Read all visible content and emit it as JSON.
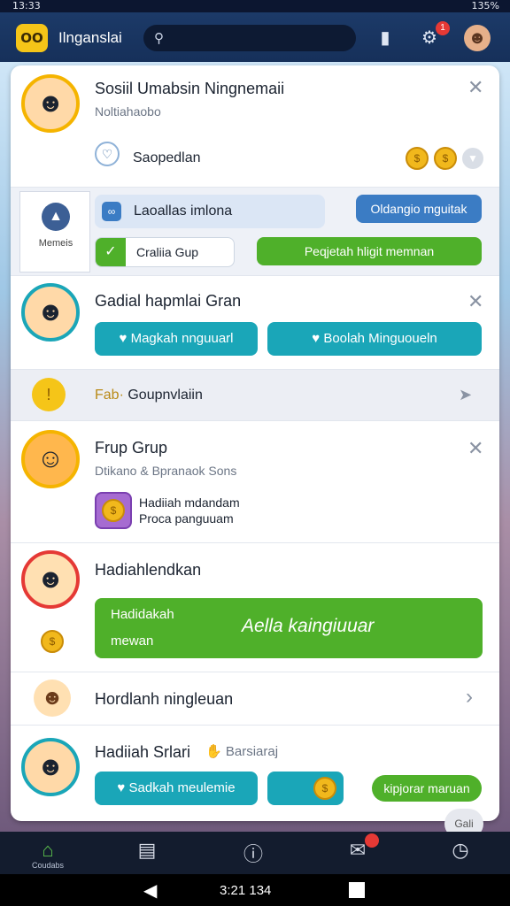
{
  "status_bar": {
    "time": "13:33",
    "battery": "135%"
  },
  "header": {
    "logo": "OO",
    "app_name": "Ilnganslai",
    "badge_count": "1"
  },
  "main": {
    "notif1": {
      "title": "Sosiil Umabsin Ningnemaii",
      "subtitle": "Noltiahaobo",
      "row_label": "Saopedlan"
    },
    "action_row": {
      "side_label": "Memeis",
      "input_label": "Laoallas imlona",
      "blue_button": "Oldangio mguitak",
      "group_button": "Craliia Gup",
      "green_button": "Peqjetah hligit memnan"
    },
    "notif2": {
      "title": "Gadial hapmlai Gran",
      "btn1": "Magkah nnguuarl",
      "btn2": "Boolah Minguoueln"
    },
    "section": {
      "label_bold": "Fab·",
      "label_rest": "Goupnvlaiin"
    },
    "notif3": {
      "title": "Frup Grup",
      "subtitle": "Dtikano & Bpranaok Sons",
      "reward_line1": "Hadiiah mdandam",
      "reward_line2": "Proca panguuam"
    },
    "notif4": {
      "title": "Hadiahlendkan",
      "banner_left1": "Hadidakah",
      "banner_left2": "mewan",
      "banner_main": "Aella kaingiuuar"
    },
    "notif5": {
      "title": "Hordlanh ningleuan"
    },
    "notif6": {
      "title": "Hadiiah Srlari",
      "tag": "Barsiaraj",
      "btn1": "Sadkah meulemie",
      "btn2": "kipjorar maruan"
    },
    "scroll_fab": "Gali"
  },
  "bottom_nav": {
    "home": "Coudabs"
  },
  "system_nav": {
    "center_text": "3:21  134"
  }
}
